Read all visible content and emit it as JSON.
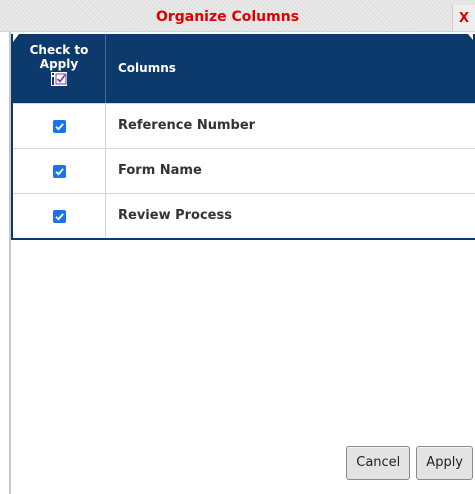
{
  "dialog": {
    "title": "Organize Columns",
    "close_label": "X"
  },
  "table": {
    "header": {
      "check_label_line1": "Check to",
      "check_label_line2": "Apply",
      "columns_label": "Columns"
    },
    "rows": [
      {
        "name": "Reference Number",
        "checked": true
      },
      {
        "name": "Form Name",
        "checked": true
      },
      {
        "name": "Review Process",
        "checked": true
      }
    ]
  },
  "buttons": {
    "cancel_label": "Cancel",
    "apply_label": "Apply"
  },
  "colors": {
    "title": "#e00000",
    "header_bg": "#0d3a6d",
    "checkbox": "#1a73e8"
  },
  "icons": {
    "check_all": "check-all-icon",
    "checkbox": "checkmark-icon"
  }
}
